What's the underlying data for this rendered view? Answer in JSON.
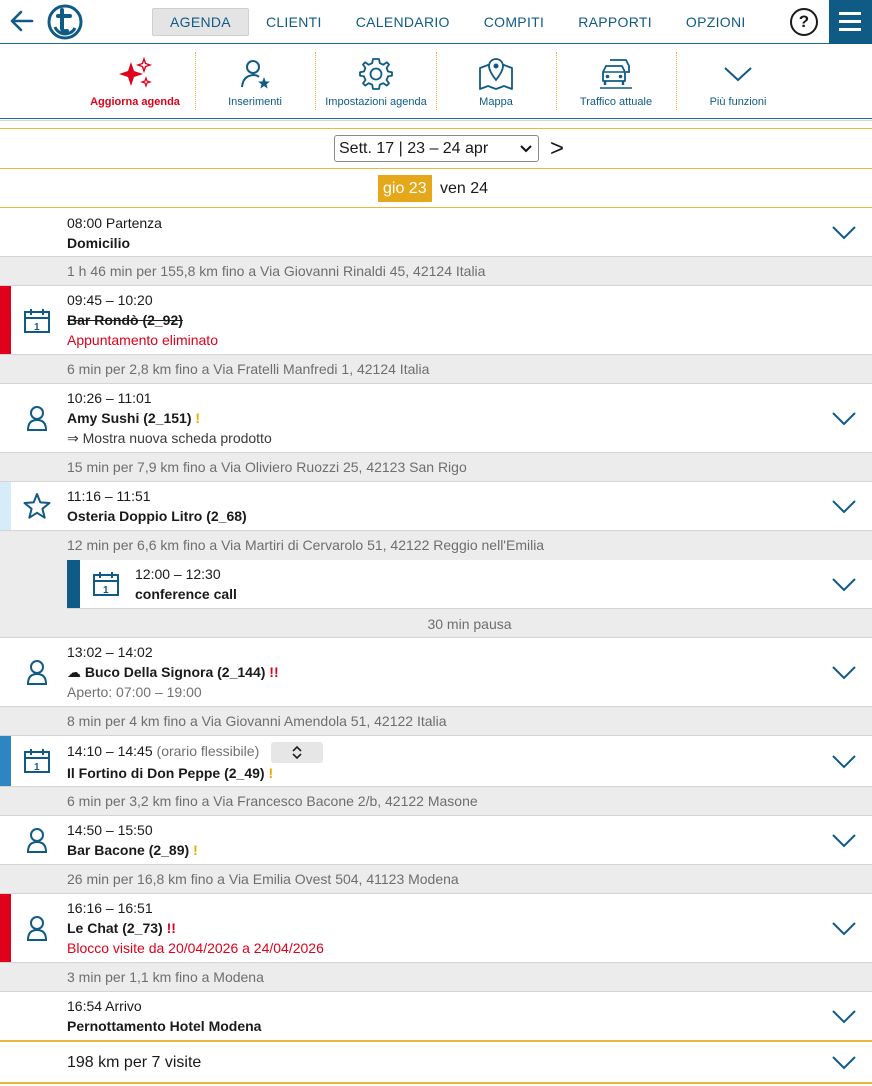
{
  "nav": {
    "tabs": [
      "AGENDA",
      "CLIENTI",
      "CALENDARIO",
      "COMPITI",
      "RAPPORTI",
      "OPZIONI"
    ],
    "active_tab": "AGENDA",
    "help": "?"
  },
  "toolbar": {
    "items": [
      {
        "label": "Aggiorna agenda",
        "icon": "sparkle-icon"
      },
      {
        "label": "Inserimenti",
        "icon": "person-star-icon"
      },
      {
        "label": "Impostazioni agenda",
        "icon": "gear-icon"
      },
      {
        "label": "Mappa",
        "icon": "map-pin-icon"
      },
      {
        "label": "Traffico attuale",
        "icon": "traffic-cars-icon"
      },
      {
        "label": "Più funzioni",
        "icon": "chevron-down-icon"
      }
    ]
  },
  "week": {
    "selected": "Sett. 17 | 23 – 24 apr",
    "next": ">",
    "days": [
      "gio 23",
      "ven 24"
    ],
    "active_day": "gio 23"
  },
  "entries": {
    "start": {
      "time": "08:00 Partenza",
      "name": "Domicilio"
    },
    "t1": "1 h 46 min per 155,8 km fino a Via Giovanni Rinaldi 45, 42124 Italia",
    "e1": {
      "time": "09:45 – 10:20",
      "name": "Bar Rondò (2_92)",
      "note": "Appuntamento eliminato"
    },
    "t2": "6 min per 2,8 km fino a Via Fratelli Manfredi 1, 42124 Italia",
    "e2": {
      "time": "10:26 – 11:01",
      "name": "Amy Sushi (2_151)",
      "flag": "!",
      "note": "⇒ Mostra nuova scheda prodotto"
    },
    "t3": "15 min per 7,9 km fino a Via Oliviero Ruozzi 25, 42123 San Rigo",
    "e3": {
      "time": "11:16 – 11:51",
      "name": "Osteria Doppio Litro (2_68)"
    },
    "t4": "12 min per 6,6 km fino a Via Martiri di Cervarolo 51, 42122 Reggio nell'Emilia",
    "e4": {
      "time": "12:00 – 12:30",
      "name": "conference call"
    },
    "pause": "30 min pausa",
    "e5": {
      "time": "13:02 – 14:02",
      "cloud": "☁",
      "name": "Buco Della Signora (2_144)",
      "flag": "!!",
      "note": "Aperto: 07:00 – 19:00"
    },
    "t5": "8 min per 4 km fino a Via Giovanni Amendola 51, 42122 Italia",
    "e6": {
      "time": "14:10 – 14:45",
      "flex": "(orario flessibile)",
      "name": "Il Fortino di Don Peppe (2_49)",
      "flag": "!"
    },
    "t6": "6 min per 3,2 km fino a Via Francesco Bacone 2/b, 42122 Masone",
    "e7": {
      "time": "14:50 – 15:50",
      "name": "Bar Bacone (2_89)",
      "flag": "!"
    },
    "t7": "26 min per 16,8 km fino a Via Emilia Ovest 504, 41123 Modena",
    "e8": {
      "time": "16:16 – 16:51",
      "name": "Le Chat (2_73)",
      "flag": "!!",
      "note": "Blocco visite da 20/04/2026 a 24/04/2026"
    },
    "t8": "3 min per 1,1 km fino a Modena",
    "end": {
      "time": "16:54 Arrivo",
      "name": "Pernottamento Hotel Modena"
    }
  },
  "summary": "198 km per 7 visite",
  "colors": {
    "brand": "#0f5b86",
    "accent": "#e4a81a",
    "alert": "#e0001b",
    "light_blue": "#d6ecf8",
    "mid_blue": "#2e86c1"
  }
}
